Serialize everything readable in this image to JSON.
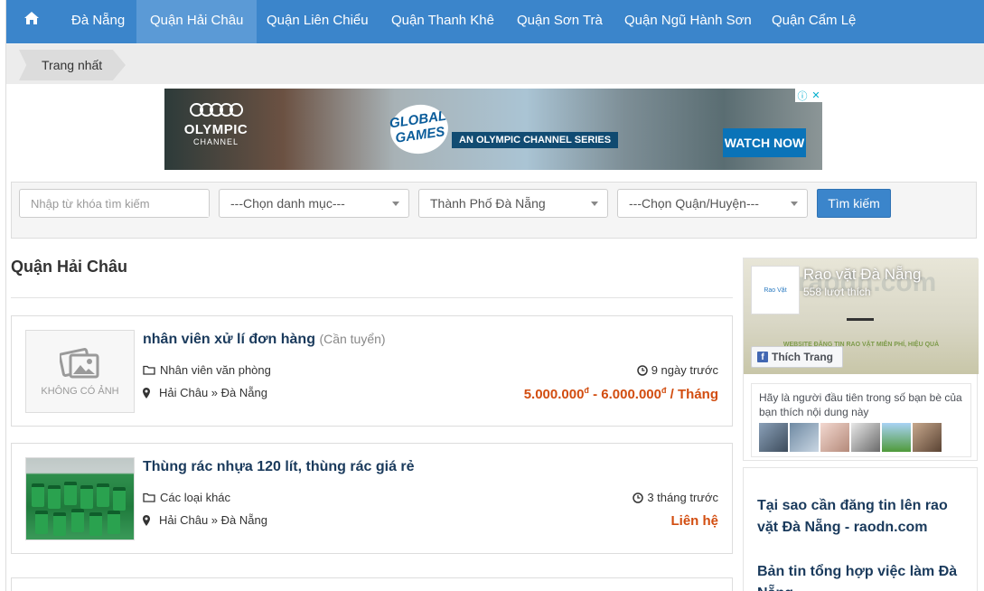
{
  "nav": {
    "home_icon": "home-icon",
    "items": [
      {
        "label": "Đà Nẵng"
      },
      {
        "label": "Quận Hải Châu",
        "active": true
      },
      {
        "label": "Quận Liên Chiểu"
      },
      {
        "label": "Quận Thanh Khê"
      },
      {
        "label": "Quận Sơn Trà"
      },
      {
        "label": "Quận Ngũ Hành Sơn"
      },
      {
        "label": "Quận Cẩm Lệ"
      }
    ]
  },
  "breadcrumb": {
    "label": "Trang nhất"
  },
  "ad": {
    "brand": "OLYMPIC",
    "brand_sub": "CHANNEL",
    "badge": "GLOBAL GAMES",
    "series": "AN OLYMPIC CHANNEL SERIES",
    "cta": "WATCH NOW"
  },
  "search": {
    "keyword_placeholder": "Nhập từ khóa tìm kiếm",
    "category": "---Chọn danh mục---",
    "city": "Thành Phố Đà Nẵng",
    "district": "---Chọn Quận/Huyện---",
    "button": "Tìm kiếm"
  },
  "page": {
    "title": "Quận Hải Châu"
  },
  "listings": [
    {
      "title": "nhân viên xử lí đơn hàng",
      "type": "(Cần tuyển)",
      "category": "Nhân viên văn phòng",
      "location": "Hải Châu » Đà Nẵng",
      "time": "9 ngày trước",
      "price_from": "5.000.000",
      "price_to": "6.000.000",
      "currency": "đ",
      "price_unit": "/ Tháng",
      "no_image_label": "KHÔNG CÓ ẢNH"
    },
    {
      "title": "Thùng rác nhựa 120 lít, thùng rác giá rẻ",
      "category": "Các loại khác",
      "location": "Hải Châu » Đà Nẵng",
      "time": "3 tháng trước",
      "price": "Liên hệ"
    }
  ],
  "facebook": {
    "page_name": "Rao vặt Đà Nẵng",
    "likes": "558 lượt thích",
    "like_button": "Thích Trang",
    "friends_text": "Hãy là người đầu tiên trong số bạn bè của bạn thích nội dung này",
    "cover_tagline": "WEBSITE ĐĂNG TIN RAO VẶT MIỄN PHÍ, HIỆU QUẢ",
    "logo_text": "Rao Vặt"
  },
  "sidebar_articles": [
    {
      "title": "Tại sao cần đăng tin lên rao vặt Đà Nẵng - raodn.com"
    },
    {
      "title": "Bản tin tổng hợp việc làm Đà Nẵng"
    }
  ],
  "colors": {
    "nav": "#3b85cb",
    "price": "#d24d10",
    "title": "#1a3a5c"
  }
}
